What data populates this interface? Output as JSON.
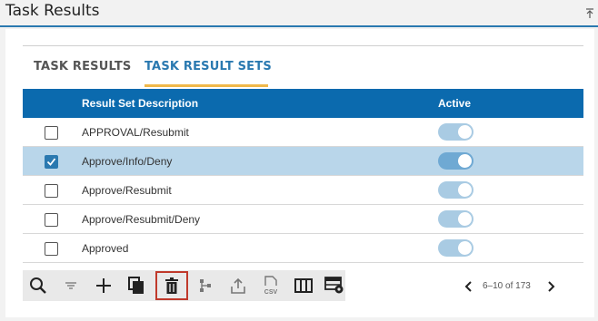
{
  "header": {
    "title": "Task Results"
  },
  "tabs": [
    {
      "label": "TASK RESULTS",
      "active": false
    },
    {
      "label": "TASK RESULT SETS",
      "active": true
    }
  ],
  "table": {
    "columns": [
      "Result Set Description",
      "Active"
    ],
    "rows": [
      {
        "description": "APPROVAL/Resubmit",
        "checked": false,
        "active": true
      },
      {
        "description": "Approve/Info/Deny",
        "checked": true,
        "active": true
      },
      {
        "description": "Approve/Resubmit",
        "checked": false,
        "active": true
      },
      {
        "description": "Approve/Resubmit/Deny",
        "checked": false,
        "active": true
      },
      {
        "description": "Approved",
        "checked": false,
        "active": true
      }
    ]
  },
  "toolbar": {
    "buttons": [
      "search-icon",
      "filter-icon",
      "add-icon",
      "copy-icon",
      "delete-icon",
      "hierarchy-icon",
      "export-icon",
      "csv-icon",
      "columns-icon",
      "table-settings-icon"
    ],
    "active_button": "delete-icon",
    "csv_label": "CSV"
  },
  "pager": {
    "info": "6–10 of 173"
  },
  "colors": {
    "accent": "#2a79b0",
    "header_bg": "#0b6aae",
    "selected_row": "#b9d6ea",
    "tab_underline": "#f0b84a"
  }
}
